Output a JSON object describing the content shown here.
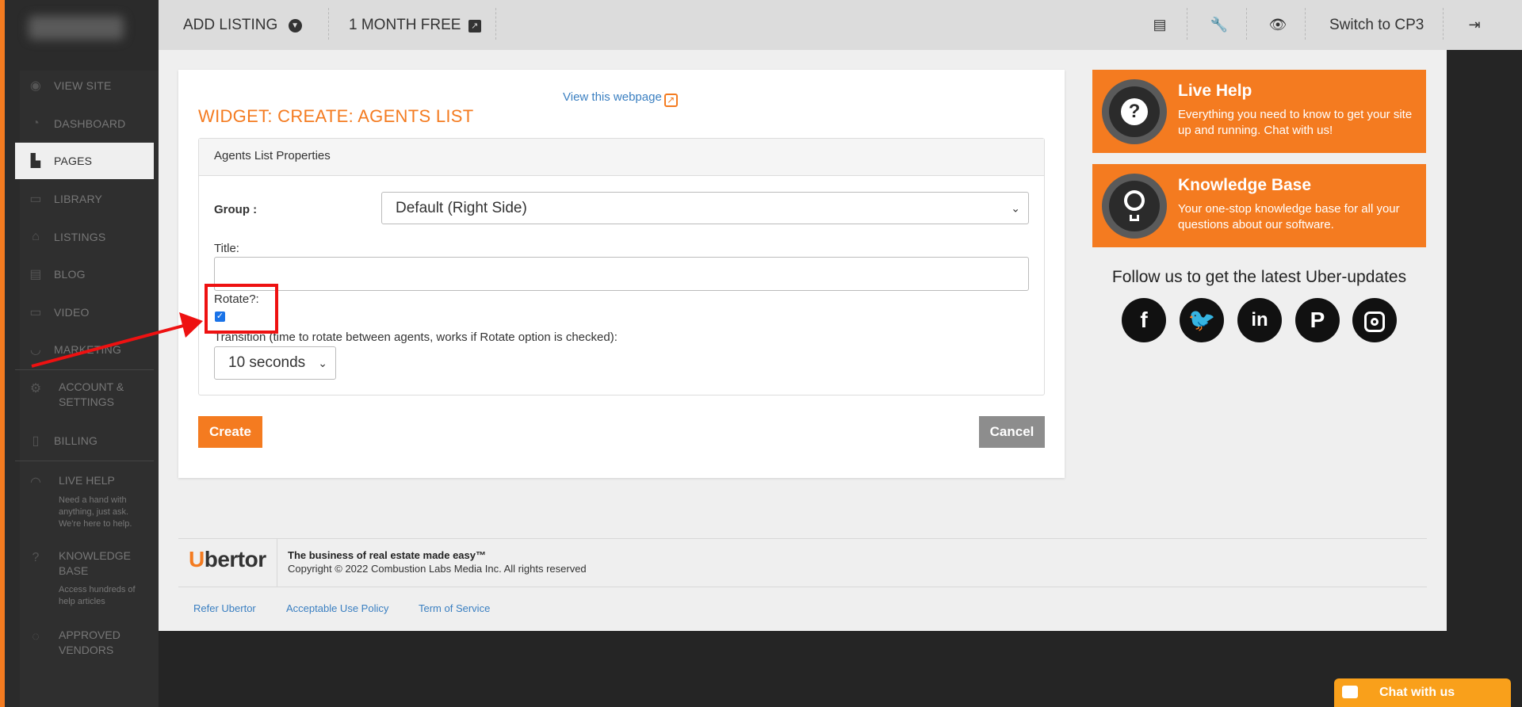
{
  "sidebar": {
    "items": [
      {
        "label": "VIEW SITE",
        "icon": "eye-icon"
      },
      {
        "label": "DASHBOARD",
        "icon": "dashboard-icon"
      },
      {
        "label": "PAGES",
        "icon": "sitemap-icon"
      },
      {
        "label": "LIBRARY",
        "icon": "monitor-icon"
      },
      {
        "label": "LISTINGS",
        "icon": "home-icon"
      },
      {
        "label": "BLOG",
        "icon": "document-icon"
      },
      {
        "label": "VIDEO",
        "icon": "video-icon"
      },
      {
        "label": "MARKETING",
        "icon": "marketing-icon"
      }
    ],
    "account": {
      "line1": "ACCOUNT &",
      "line2": "SETTINGS"
    },
    "billing": "BILLING",
    "live_help": {
      "title": "LIVE HELP",
      "sub": "Need a hand with anything, just ask. We're here to help."
    },
    "knowledge": {
      "line1": "KNOWLEDGE",
      "line2": "BASE",
      "sub": "Access hundreds of help articles"
    },
    "vendors": {
      "line1": "APPROVED",
      "line2": "VENDORS"
    }
  },
  "topbar": {
    "add_listing": "ADD LISTING",
    "month_free": "1 MONTH FREE",
    "switch": "Switch to CP3"
  },
  "main": {
    "view_link": "View this webpage",
    "heading": "WIDGET: CREATE: AGENTS LIST",
    "panel_title": "Agents List Properties",
    "group_label": "Group :",
    "group_value": "Default (Right Side)",
    "title_label": "Title:",
    "title_value": "",
    "rotate_label": "Rotate?:",
    "rotate_checked": true,
    "transition_label": "Transition (time to rotate between agents, works if Rotate option is checked):",
    "transition_value": "10 seconds",
    "create_label": "Create",
    "cancel_label": "Cancel"
  },
  "promo": {
    "live_help_title": "Live Help",
    "live_help_desc": "Everything you need to know to get your site up and running. Chat with us!",
    "kb_title": "Knowledge Base",
    "kb_desc": "Your one-stop knowledge base for all your questions about our software.",
    "follow": "Follow us to get the latest Uber-updates",
    "social": [
      "facebook-icon",
      "twitter-icon",
      "linkedin-icon",
      "pinterest-icon",
      "instagram-icon"
    ]
  },
  "footer": {
    "logo_u": "U",
    "logo_rest": "bertor",
    "tagline": "The business of real estate made easy™",
    "copyright": "Copyright © 2022 Combustion Labs Media Inc. All rights reserved",
    "links": [
      "Refer Ubertor",
      "Acceptable Use Policy",
      "Term of Service"
    ]
  },
  "chat": {
    "label": "Chat with us"
  },
  "colors": {
    "accent": "#f47b20",
    "link": "#3a7fc1",
    "sidebar": "#2f2f2f",
    "highlight": "#ee1111"
  }
}
